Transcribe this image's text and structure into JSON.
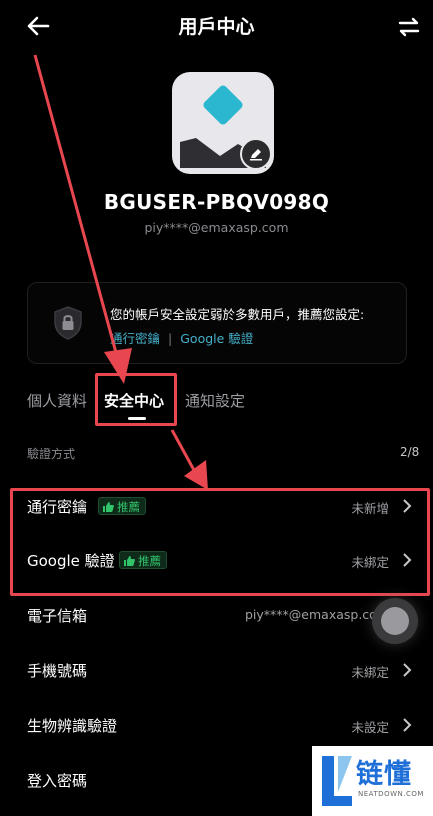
{
  "header": {
    "title": "用戶中心",
    "back_icon": "arrow-left-icon",
    "swap_icon": "swap-icon"
  },
  "profile": {
    "username": "BGUSER-PBQV098Q",
    "email": "piy****@emaxasp.com"
  },
  "security_card": {
    "message": "您的帳戶安全設定弱於多數用戶，推薦您設定:",
    "link_passkey": "通行密鑰",
    "separator": "|",
    "link_google": "Google 驗證",
    "icon": "shield-lock-icon"
  },
  "tabs": [
    {
      "label": "個人資料",
      "active": false
    },
    {
      "label": "安全中心",
      "active": true
    },
    {
      "label": "通知設定",
      "active": false
    }
  ],
  "section": {
    "label": "驗證方式",
    "count": "2/8"
  },
  "rows": [
    {
      "label": "通行密鑰",
      "badge": "推薦",
      "value": "未新增"
    },
    {
      "label": "Google 驗證",
      "badge": "推薦",
      "value": "未綁定"
    },
    {
      "label": "電子信箱",
      "badge": "",
      "value": "piy****@emaxasp.com"
    },
    {
      "label": "手機號碼",
      "badge": "",
      "value": "未綁定"
    },
    {
      "label": "生物辨識驗證",
      "badge": "",
      "value": "未設定"
    },
    {
      "label": "登入密碼",
      "badge": "",
      "value": ""
    }
  ],
  "watermark": {
    "text": "链懂",
    "sub": "NEATDOWN.COM"
  },
  "colors": {
    "accent": "#45b0c9",
    "badge_green": "#32c46b",
    "annotation_red": "#e8474f",
    "background": "#000000"
  }
}
